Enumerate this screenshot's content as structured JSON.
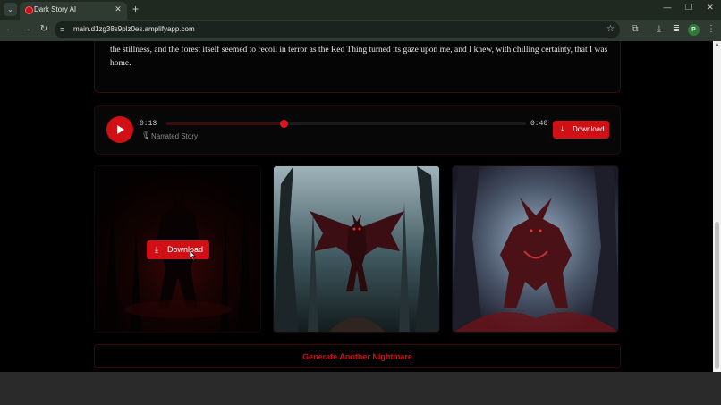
{
  "browser": {
    "tab_title": "Dark Story AI",
    "tab_close_glyph": "✕",
    "new_tab_glyph": "+",
    "tab_list_glyph": "⌄",
    "url": "main.d1zg38s9plz0es.amplifyapp.com",
    "profile_initial": "P",
    "window_controls": {
      "minimize": "—",
      "restore": "❐",
      "close": "✕"
    },
    "nav": {
      "back": "←",
      "forward": "→",
      "reload": "↻"
    },
    "icons": {
      "site_info": "≡",
      "bookmark": "☆",
      "extensions": "⧉",
      "downloads": "⤓",
      "media": "≣",
      "menu": "⋮"
    }
  },
  "story": {
    "text": "the stillness, and the forest itself seemed to recoil in terror as the Red Thing turned its gaze upon me, and I knew, with chilling certainty, that I was home."
  },
  "audio": {
    "current_time": "0:13",
    "total_time": "0:40",
    "progress": 0.325,
    "label": "Narrated Story",
    "download_label": "Download"
  },
  "gallery": {
    "images": [
      {
        "name": "demon-silhouette-image",
        "hovered": true,
        "download_label": "Download"
      },
      {
        "name": "winged-demon-image",
        "hovered": false
      },
      {
        "name": "horned-beast-image",
        "hovered": false
      }
    ]
  },
  "actions": {
    "generate_label": "Generate Another Nightmare"
  },
  "colors": {
    "accent": "#d01015",
    "background": "#000000",
    "chrome": "#2f3a33"
  }
}
